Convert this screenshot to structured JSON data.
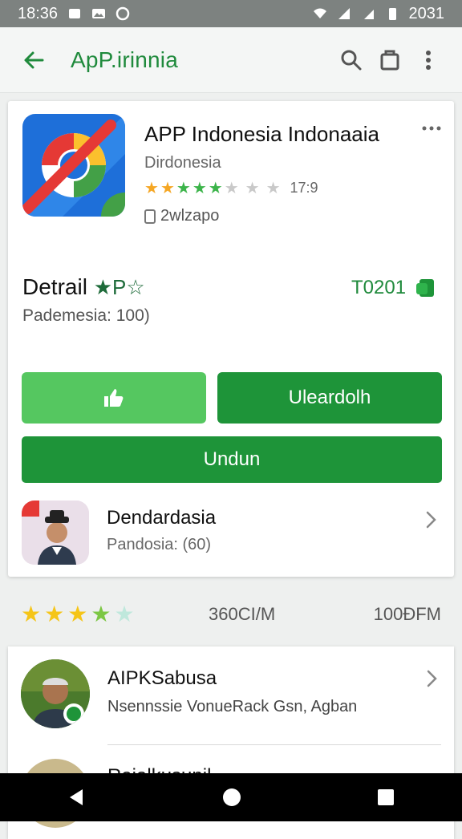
{
  "status_bar": {
    "time": "18:36",
    "right_text": "2031"
  },
  "app_bar": {
    "title": "ApP.irinnia"
  },
  "app": {
    "name": "APP Indonesia Indonaaia",
    "developer": "Dirdonesia",
    "rating_count": "17:9",
    "rating": 3.5,
    "age_label": "2wlzapo"
  },
  "detail": {
    "title": "Detrail",
    "title_suffix": "★P☆",
    "subtitle": "Pademesia: 100)",
    "price": "T0201"
  },
  "buttons": {
    "upgrade_label": "Uleardolh",
    "install_label": "Undun"
  },
  "promo": {
    "title": "Dendardasia",
    "subtitle": "Pandosia: (60)"
  },
  "summary": {
    "rating": 4,
    "mid_text": "360CI/M",
    "right_text": "100ÐFM"
  },
  "list": [
    {
      "title": "AIPKSabusa",
      "subtitle": "Nsennssie VonueRack Gsn, Agban"
    },
    {
      "title": "Rajalkusunil"
    }
  ],
  "colors": {
    "accent": "#1e9439",
    "accent_light": "#55c760",
    "star_orange": "#f5a623",
    "star_green": "#3cb44a"
  }
}
